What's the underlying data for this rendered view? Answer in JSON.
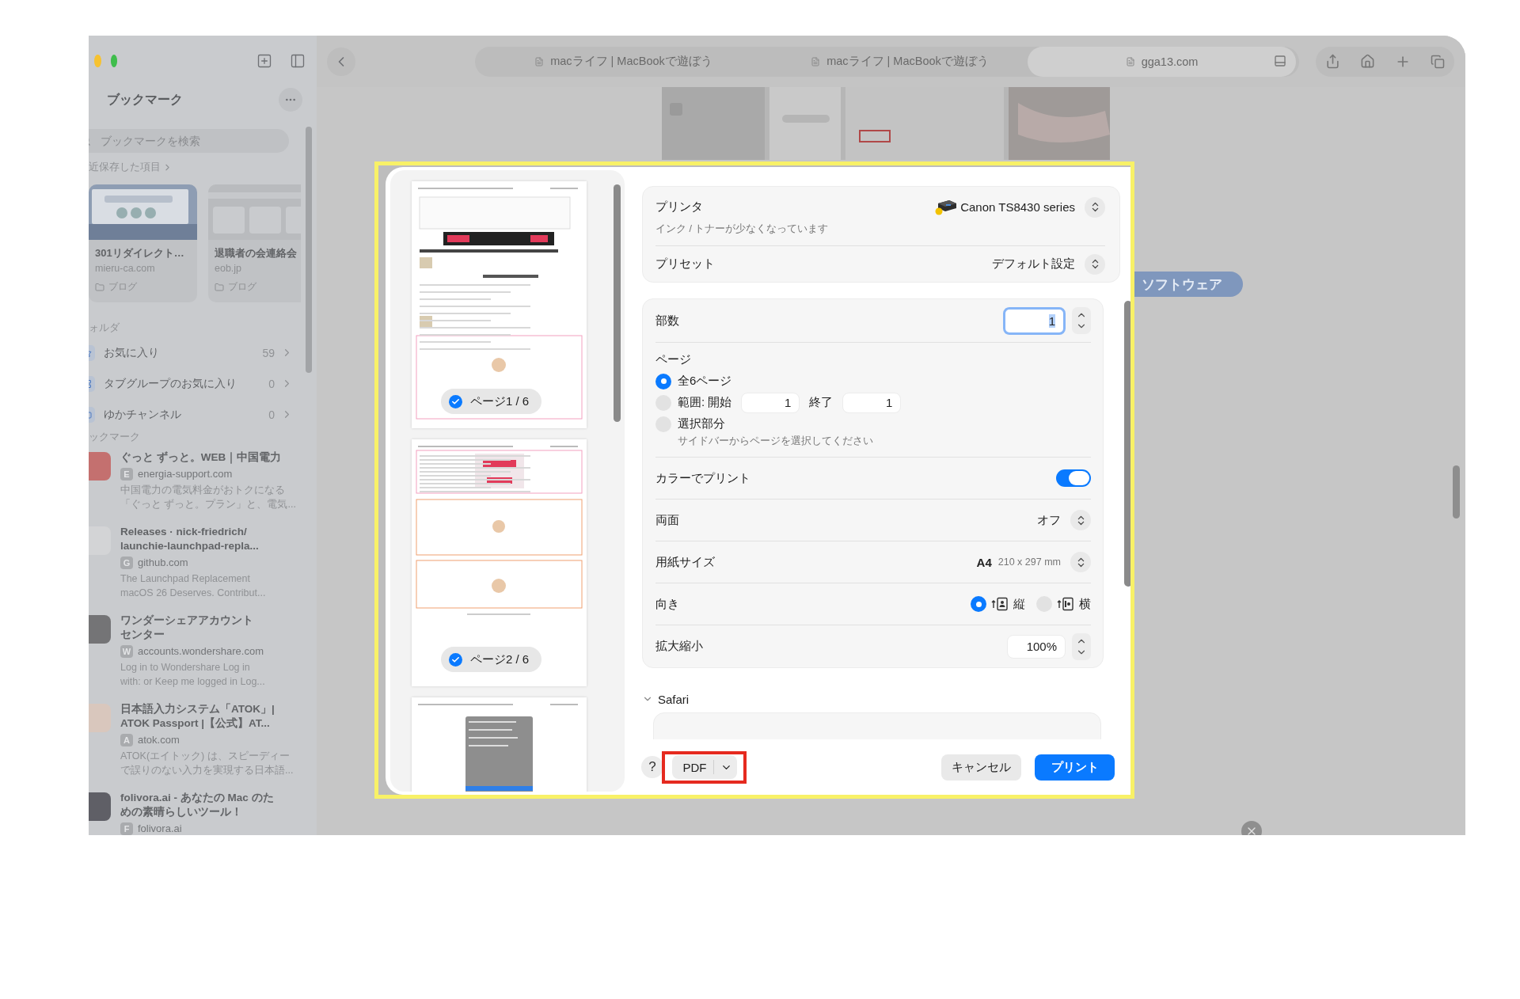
{
  "window": {
    "tabs": [
      {
        "title": "macライフ | MacBookで遊ぼう",
        "selected": false
      },
      {
        "title": "macライフ | MacBookで遊ぼう",
        "selected": false
      },
      {
        "title": "gga13.com",
        "selected": true
      }
    ]
  },
  "sidebar": {
    "title": "ブックマーク",
    "search": {
      "placeholder": "ブックマークを検索"
    },
    "recent_label": "近保存した項目",
    "recent_cards": [
      {
        "title": "301リダイレクト…",
        "domain": "mieru-ca.com",
        "folder": "ブログ"
      },
      {
        "title": "退職者の会連絡会",
        "domain": "eob.jp",
        "folder": "ブログ"
      }
    ],
    "folders_label": "ォルダ",
    "folders": [
      {
        "name": "お気に入り",
        "count": "59",
        "kind": "favorites"
      },
      {
        "name": "タブグループのお気に入り",
        "count": "0",
        "kind": "tabgroup"
      },
      {
        "name": "ゆかチャンネル",
        "count": "0",
        "kind": "folder"
      }
    ],
    "bookmarks_label": "ックマーク",
    "bookmarks": [
      {
        "title_lines": [
          "ぐっと ずっと。WEB｜中国電力"
        ],
        "favicon": "E",
        "domain": "energia-support.com",
        "description_lines": [
          "中国電力の電気料金がおトクになる",
          "「ぐっと ずっと。プラン」と、電気..."
        ],
        "color": "#c4706f"
      },
      {
        "title_lines": [
          "Releases · nick-friedrich/",
          "launchie-launchpad-repla..."
        ],
        "favicon": "G",
        "domain": "github.com",
        "description_lines": [
          "The Launchpad Replacement",
          "macOS 26 Deserves. Contribut..."
        ],
        "color": "#d3d4d6"
      },
      {
        "title_lines": [
          "ワンダーシェアアカウント",
          "センター"
        ],
        "favicon": "W",
        "domain": "accounts.wondershare.com",
        "description_lines": [
          "Log in to Wondershare Log in",
          "with: or Keep me logged in Log..."
        ],
        "color": "#747476"
      },
      {
        "title_lines": [
          "日本語入力システム「ATOK」|",
          "ATOK Passport |【公式】AT..."
        ],
        "favicon": "A",
        "domain": "atok.com",
        "description_lines": [
          "ATOK(エイトック) は、スピーディー",
          "で誤りのない入力を実現する日本語..."
        ],
        "color": "#d9c7bd"
      },
      {
        "title_lines": [
          "folivora.ai - あなたの Mac のた",
          "めの素晴らしいツール！"
        ],
        "favicon": "F",
        "domain": "folivora.ai",
        "color": "#5f5f66"
      }
    ]
  },
  "page": {
    "tag": "ソフトウェア"
  },
  "print_dialog": {
    "highlighted": true,
    "previews": [
      {
        "label": "ページ1 / 6",
        "checked": true
      },
      {
        "label": "ページ2 / 6",
        "checked": true
      }
    ],
    "printer": {
      "label": "プリンタ",
      "value": "Canon TS8430 series",
      "warning": "インク / トナーが少なくなっています"
    },
    "preset": {
      "label": "プリセット",
      "value": "デフォルト設定"
    },
    "copies": {
      "label": "部数",
      "value": "1",
      "focused": true
    },
    "pages": {
      "label": "ページ",
      "options": [
        {
          "kind": "all",
          "label": "全6ページ",
          "selected": true
        },
        {
          "kind": "range",
          "label": "範囲: 開始",
          "selected": false,
          "from": "1",
          "to_label": "終了",
          "to": "1"
        },
        {
          "kind": "selection",
          "label": "選択部分",
          "selected": false,
          "hint": "サイドバーからページを選択してください"
        }
      ]
    },
    "color": {
      "label": "カラーでプリント",
      "on": true
    },
    "duplex": {
      "label": "両面",
      "value": "オフ"
    },
    "paper": {
      "label": "用紙サイズ",
      "value": "A4",
      "detail": "210 x 297 mm"
    },
    "orientation": {
      "label": "向き",
      "options": [
        {
          "kind": "portrait",
          "label": "縦",
          "selected": true
        },
        {
          "kind": "landscape",
          "label": "横",
          "selected": false
        }
      ]
    },
    "scale": {
      "label": "拡大縮小",
      "value": "100%"
    },
    "section": {
      "label": "Safari",
      "expanded": true
    },
    "footer": {
      "help": "?",
      "pdf": "PDF",
      "pdf_highlighted": true,
      "cancel": "キャンセル",
      "print": "プリント"
    }
  }
}
